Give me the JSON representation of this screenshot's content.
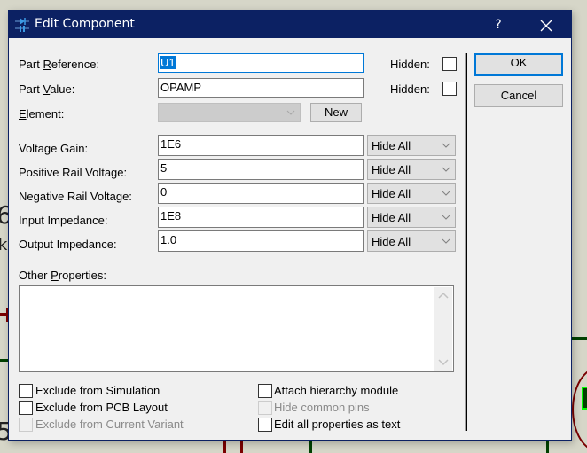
{
  "window": {
    "title": "Edit Component",
    "help_label": "?",
    "icon": "component-icon",
    "close_icon": "close-icon"
  },
  "fields": {
    "part_reference": {
      "label_pre": "Part ",
      "label_ul": "R",
      "label_post": "eference:",
      "value": "U1",
      "hidden_label": "Hidden:",
      "hidden": false
    },
    "part_value": {
      "label_pre": "Part ",
      "label_ul": "V",
      "label_post": "alue:",
      "value": "OPAMP",
      "hidden_label": "Hidden:",
      "hidden": false
    },
    "element": {
      "label_ul": "E",
      "label_post": "lement:",
      "value": "",
      "new_button": "New"
    }
  },
  "properties": [
    {
      "label": "Voltage Gain:",
      "value": "1E6",
      "visibility": "Hide All"
    },
    {
      "label": "Positive Rail Voltage:",
      "value": "5",
      "visibility": "Hide All"
    },
    {
      "label": "Negative Rail Voltage:",
      "value": "0",
      "visibility": "Hide All"
    },
    {
      "label": "Input Impedance:",
      "value": "1E8",
      "visibility": "Hide All"
    },
    {
      "label": "Output Impedance:",
      "value": "1.0",
      "visibility": "Hide All"
    }
  ],
  "other_properties": {
    "label_pre": "Other ",
    "label_ul": "P",
    "label_post": "roperties:",
    "value": ""
  },
  "checkboxes_left": [
    {
      "label": "Exclude from Simulation",
      "checked": false,
      "enabled": true
    },
    {
      "label": "Exclude from PCB Layout",
      "checked": false,
      "enabled": true
    },
    {
      "label": "Exclude from Current Variant",
      "checked": false,
      "enabled": false
    }
  ],
  "checkboxes_right": [
    {
      "label": "Attach hierarchy module",
      "checked": false,
      "enabled": true
    },
    {
      "label": "Hide common pins",
      "checked": false,
      "enabled": false
    },
    {
      "label": "Edit all properties as text",
      "checked": false,
      "enabled": true
    }
  ],
  "buttons": {
    "ok": "OK",
    "cancel": "Cancel"
  },
  "background": {
    "glyph_1": "6",
    "glyph_2": "k",
    "glyph_3": "5"
  },
  "colors": {
    "titlebar": "#0c2163",
    "focus": "#0078d7",
    "wire_red": "#7a0000",
    "wire_green": "#004000",
    "pin_green": "#00ff00"
  }
}
